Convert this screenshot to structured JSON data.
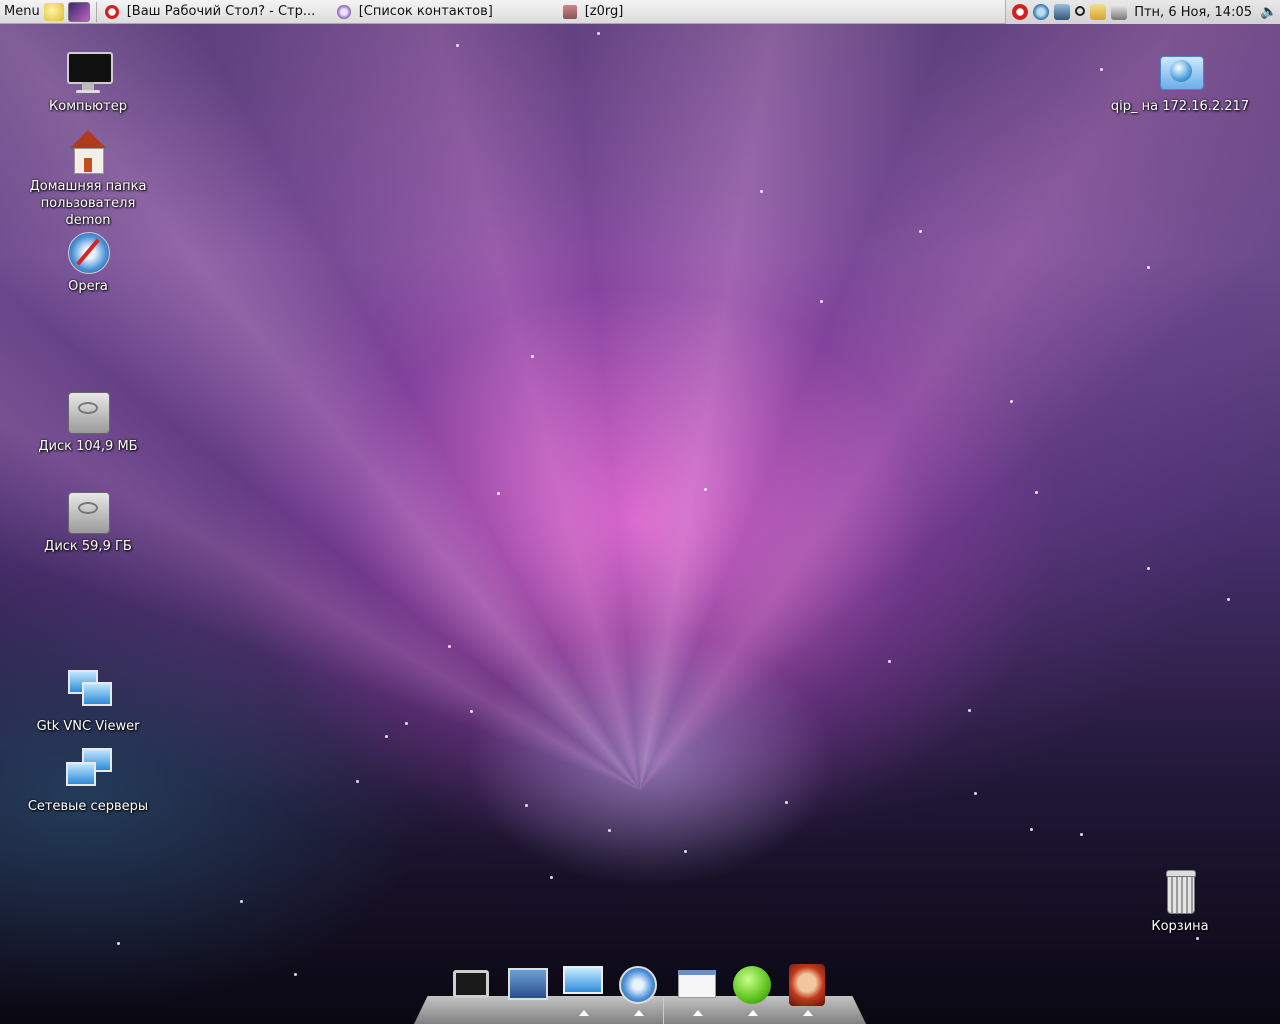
{
  "panel": {
    "menu_label": "Menu",
    "tasks": [
      {
        "label": "[Ваш Рабочий Стол? - Стр...",
        "icon": "opera-icon"
      },
      {
        "label": "[Список контактов]",
        "icon": "qip-icon"
      },
      {
        "label": "[z0rg]",
        "icon": "terminal-icon"
      }
    ],
    "clock": "Птн,  6 Ноя, 14:05"
  },
  "desktop": {
    "left_icons": [
      {
        "label": "Компьютер",
        "icon": "computer-icon"
      },
      {
        "label": "Домашняя папка пользователя demon",
        "icon": "home-folder-icon"
      },
      {
        "label": "Opera",
        "icon": "opera-browser-icon"
      },
      {
        "label": "Диск 104,9 МБ",
        "icon": "drive-icon"
      },
      {
        "label": "Диск 59,9 ГБ",
        "icon": "drive-icon"
      },
      {
        "label": "Gtk VNC Viewer",
        "icon": "vnc-viewer-icon"
      },
      {
        "label": "Сетевые серверы",
        "icon": "network-servers-icon"
      }
    ],
    "right_icons": [
      {
        "label": "qip_ на 172.16.2.217",
        "icon": "network-folder-icon"
      },
      {
        "label": "Корзина",
        "icon": "trash-icon"
      }
    ]
  },
  "dock": {
    "items": [
      "terminal-icon",
      "desktop-icon",
      "monitor-icon",
      "compass-icon",
      "window-icon",
      "green-ball-icon",
      "avatar-icon"
    ]
  },
  "colors": {
    "panel_bg": "#e6e6e6",
    "wallpaper_pink": "#e86fd6",
    "wallpaper_dark": "#0a0812"
  }
}
